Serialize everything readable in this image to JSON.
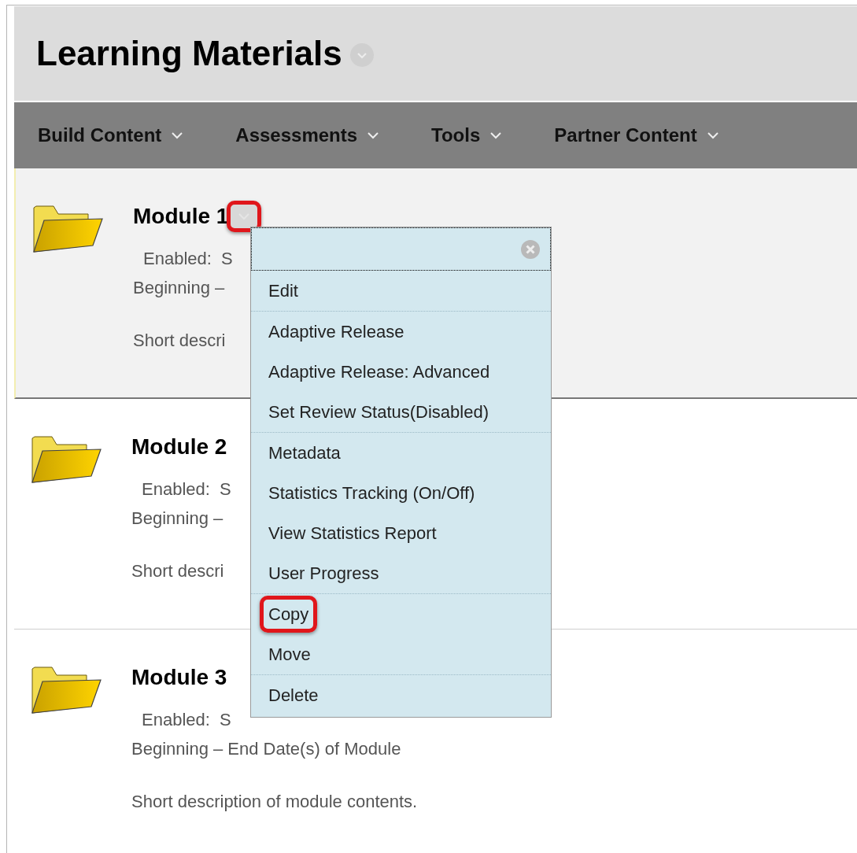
{
  "page_title": "Learning Materials",
  "toolbar": [
    {
      "label": "Build Content"
    },
    {
      "label": "Assessments"
    },
    {
      "label": "Tools"
    },
    {
      "label": "Partner Content"
    }
  ],
  "modules": [
    {
      "title": "Module 1",
      "selected": true,
      "menu_open": true,
      "enabled": "Enabled:  S",
      "dates": "Beginning –",
      "description": "Short descri"
    },
    {
      "title": "Module 2",
      "selected": false,
      "menu_open": false,
      "enabled": "Enabled:  S",
      "dates": "Beginning –",
      "description": "Short descri"
    },
    {
      "title": "Module 3",
      "selected": false,
      "menu_open": false,
      "enabled": "Enabled:  S",
      "dates": "Beginning – End Date(s) of Module",
      "description": "Short description of module contents."
    }
  ],
  "context_menu": {
    "groups": [
      [
        {
          "label": "Edit",
          "highlighted": false
        }
      ],
      [
        {
          "label": "Adaptive Release",
          "highlighted": false
        },
        {
          "label": "Adaptive Release: Advanced",
          "highlighted": false
        },
        {
          "label": "Set Review Status(Disabled)",
          "highlighted": false
        }
      ],
      [
        {
          "label": "Metadata",
          "highlighted": false
        },
        {
          "label": "Statistics Tracking (On/Off)",
          "highlighted": false
        },
        {
          "label": "View Statistics Report",
          "highlighted": false
        },
        {
          "label": "User Progress",
          "highlighted": false
        }
      ],
      [
        {
          "label": "Copy",
          "highlighted": true
        },
        {
          "label": "Move",
          "highlighted": false
        }
      ],
      [
        {
          "label": "Delete",
          "highlighted": false
        }
      ]
    ]
  }
}
